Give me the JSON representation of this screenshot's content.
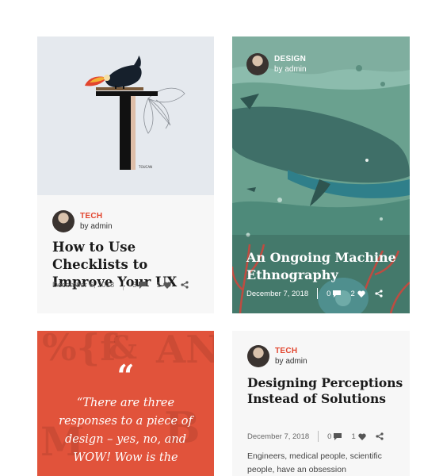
{
  "posts": [
    {
      "category": "TECH",
      "byline": "by admin",
      "title": "How to Use Checklists to Improve Your UX",
      "date": "December 6, 2018",
      "comments": "3",
      "likes": "1",
      "image_caption": "TOUCAN"
    },
    {
      "category": "DESIGN",
      "byline": "by admin",
      "title": "An Ongoing Machine Ethnography",
      "date": "December 7, 2018",
      "comments": "0",
      "likes": "2"
    },
    {
      "quote_mark": "“",
      "quote": "“There are three responses to a piece of design – yes, no, and WOW! Wow is the"
    },
    {
      "category": "TECH",
      "byline": "by admin",
      "title": "Designing Perceptions Instead of Solutions",
      "date": "December 7, 2018",
      "comments": "0",
      "likes": "1",
      "excerpt": "Engineers, medical people, scientific people, have an obsession"
    }
  ],
  "icons": {
    "comment": "comment-icon",
    "like": "heart-icon",
    "share": "share-icon"
  },
  "colors": {
    "accent": "#e2452e",
    "quote_bg": "#e1533b",
    "card_bg": "#f7f7f7"
  }
}
